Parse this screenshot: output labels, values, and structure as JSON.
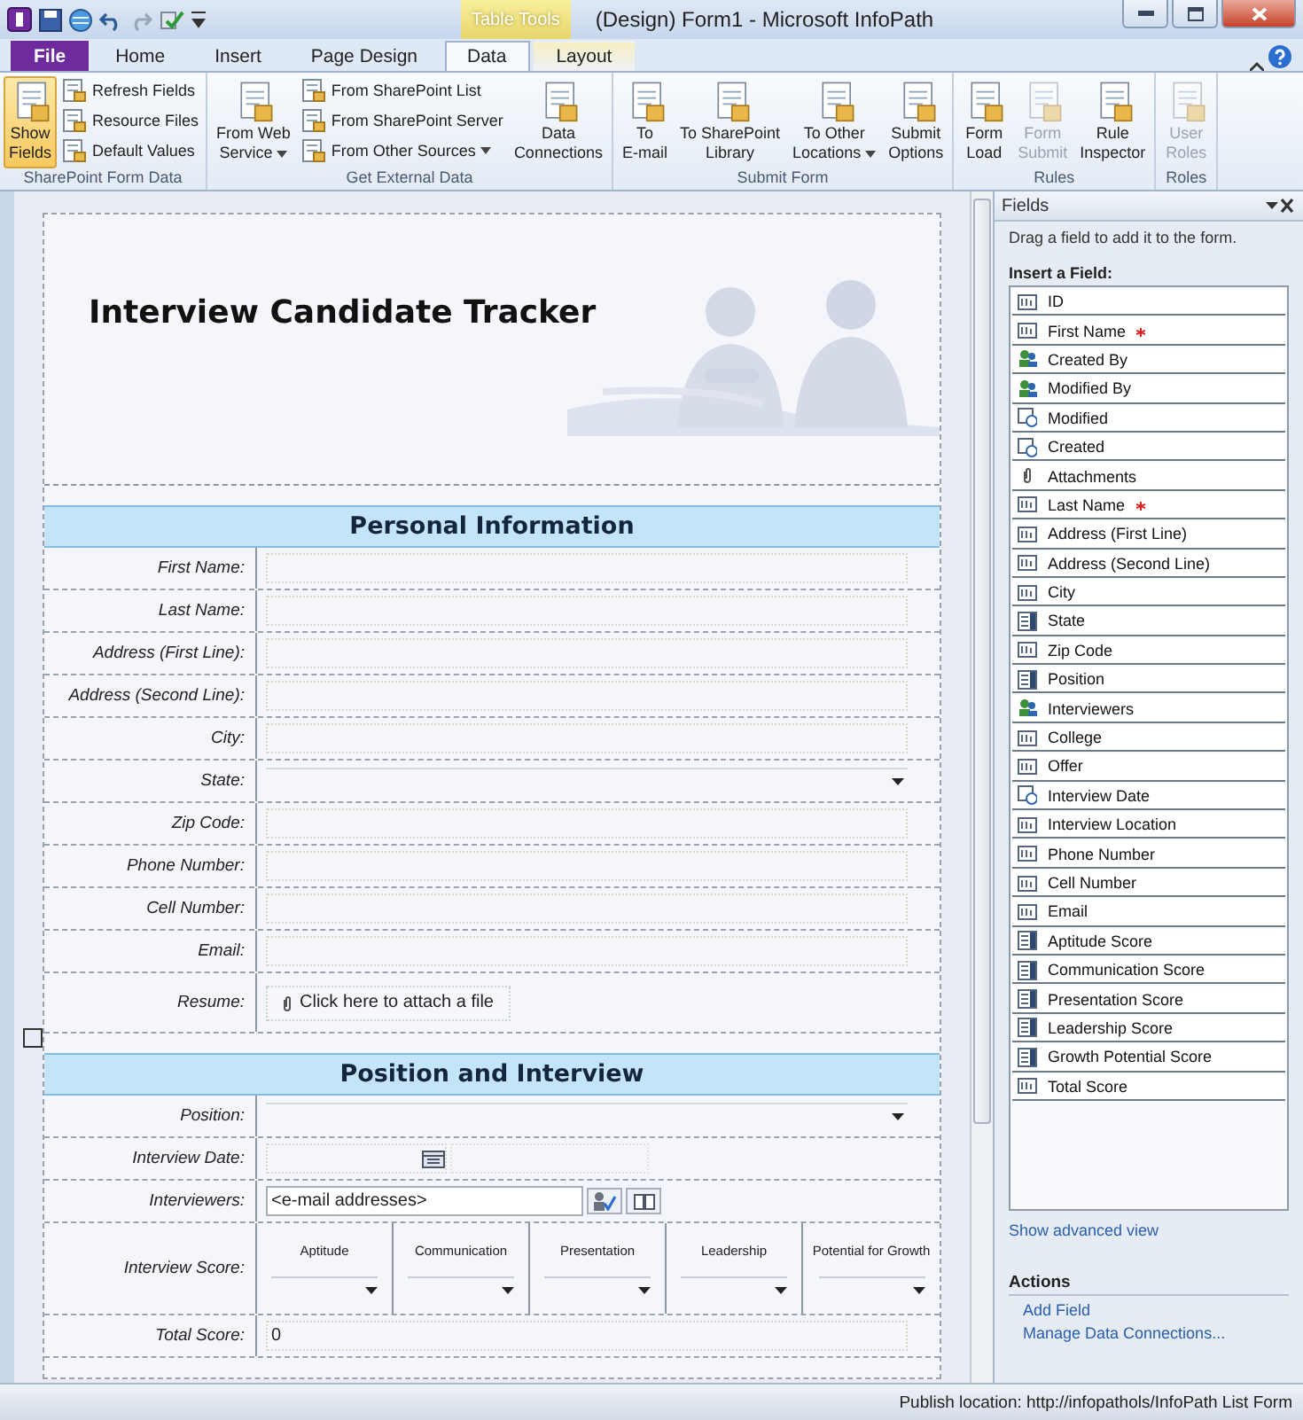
{
  "window": {
    "title": "(Design) Form1  -  Microsoft InfoPath",
    "context_label": "Table Tools"
  },
  "tabs": [
    {
      "label": "File",
      "kind": "file",
      "selected": false
    },
    {
      "label": "Home",
      "kind": "normal",
      "selected": false
    },
    {
      "label": "Insert",
      "kind": "normal",
      "selected": false
    },
    {
      "label": "Page Design",
      "kind": "normal",
      "selected": false
    },
    {
      "label": "Data",
      "kind": "normal",
      "selected": true
    },
    {
      "label": "Layout",
      "kind": "context",
      "selected": false
    }
  ],
  "ribbon_groups": [
    {
      "label": "SharePoint Form Data",
      "buttons": [
        {
          "kind": "large",
          "lines": [
            "Show",
            "Fields"
          ],
          "selected": true,
          "disabled": false,
          "dropdown": false
        },
        {
          "kind": "small",
          "lines": [
            "Refresh Fields"
          ],
          "selected": false,
          "disabled": false,
          "dropdown": false
        },
        {
          "kind": "small",
          "lines": [
            "Resource Files"
          ],
          "selected": false,
          "disabled": false,
          "dropdown": false
        },
        {
          "kind": "small",
          "lines": [
            "Default Values"
          ],
          "selected": false,
          "disabled": false,
          "dropdown": false
        }
      ]
    },
    {
      "label": "Get External Data",
      "buttons": [
        {
          "kind": "large",
          "lines": [
            "From Web",
            "Service"
          ],
          "selected": false,
          "disabled": false,
          "dropdown": true
        },
        {
          "kind": "small",
          "lines": [
            "From SharePoint List"
          ],
          "selected": false,
          "disabled": false,
          "dropdown": false
        },
        {
          "kind": "small",
          "lines": [
            "From SharePoint Server"
          ],
          "selected": false,
          "disabled": false,
          "dropdown": false
        },
        {
          "kind": "small",
          "lines": [
            "From Other Sources"
          ],
          "selected": false,
          "disabled": false,
          "dropdown": true
        },
        {
          "kind": "large",
          "lines": [
            "Data",
            "Connections"
          ],
          "selected": false,
          "disabled": false,
          "dropdown": false
        }
      ]
    },
    {
      "label": "Submit Form",
      "buttons": [
        {
          "kind": "large",
          "lines": [
            "To",
            "E-mail"
          ],
          "selected": false,
          "disabled": false,
          "dropdown": false
        },
        {
          "kind": "large",
          "lines": [
            "To SharePoint",
            "Library"
          ],
          "selected": false,
          "disabled": false,
          "dropdown": false
        },
        {
          "kind": "large",
          "lines": [
            "To Other",
            "Locations"
          ],
          "selected": false,
          "disabled": false,
          "dropdown": true
        },
        {
          "kind": "large",
          "lines": [
            "Submit",
            "Options"
          ],
          "selected": false,
          "disabled": false,
          "dropdown": false
        }
      ]
    },
    {
      "label": "Rules",
      "buttons": [
        {
          "kind": "large",
          "lines": [
            "Form",
            "Load"
          ],
          "selected": false,
          "disabled": false,
          "dropdown": false
        },
        {
          "kind": "large",
          "lines": [
            "Form",
            "Submit"
          ],
          "selected": false,
          "disabled": true,
          "dropdown": false
        },
        {
          "kind": "large",
          "lines": [
            "Rule",
            "Inspector"
          ],
          "selected": false,
          "disabled": false,
          "dropdown": false
        }
      ]
    },
    {
      "label": "Roles",
      "buttons": [
        {
          "kind": "large",
          "lines": [
            "User",
            "Roles"
          ],
          "selected": false,
          "disabled": true,
          "dropdown": false
        }
      ]
    }
  ],
  "form": {
    "title": "Interview Candidate Tracker",
    "sections": [
      {
        "heading": "Personal Information",
        "rows": [
          {
            "label": "First Name:",
            "kind": "text"
          },
          {
            "label": "Last Name:",
            "kind": "text"
          },
          {
            "label": "Address (First Line):",
            "kind": "text"
          },
          {
            "label": "Address (Second Line):",
            "kind": "text"
          },
          {
            "label": "City:",
            "kind": "text"
          },
          {
            "label": "State:",
            "kind": "dropdown"
          },
          {
            "label": "Zip Code:",
            "kind": "text"
          },
          {
            "label": "Phone Number:",
            "kind": "text"
          },
          {
            "label": "Cell Number:",
            "kind": "text"
          },
          {
            "label": "Email:",
            "kind": "text"
          },
          {
            "label": "Resume:",
            "kind": "attach",
            "value": "Click here to attach a file"
          }
        ]
      },
      {
        "heading": "Position and Interview",
        "rows": [
          {
            "label": "Position:",
            "kind": "dropdown"
          },
          {
            "label": "Interview Date:",
            "kind": "date"
          },
          {
            "label": "Interviewers:",
            "kind": "people",
            "placeholder": "<e-mail addresses>"
          },
          {
            "label": "Interview Score:",
            "kind": "scores",
            "columns": [
              "Aptitude",
              "Communication",
              "Presentation",
              "Leadership",
              "Potential for Growth"
            ]
          },
          {
            "label": "Total Score:",
            "kind": "text",
            "value": "0"
          }
        ]
      }
    ]
  },
  "fields_pane": {
    "title": "Fields",
    "hint": "Drag a field to add it to the form.",
    "list_label": "Insert a Field:",
    "fields": [
      {
        "name": "ID",
        "kind": "text",
        "required": false
      },
      {
        "name": "First Name",
        "kind": "text",
        "required": true
      },
      {
        "name": "Created By",
        "kind": "person",
        "required": false
      },
      {
        "name": "Modified By",
        "kind": "person",
        "required": false
      },
      {
        "name": "Modified",
        "kind": "date",
        "required": false
      },
      {
        "name": "Created",
        "kind": "date",
        "required": false
      },
      {
        "name": "Attachments",
        "kind": "attachment",
        "required": false
      },
      {
        "name": "Last Name",
        "kind": "text",
        "required": true
      },
      {
        "name": "Address (First Line)",
        "kind": "text",
        "required": false
      },
      {
        "name": "Address (Second Line)",
        "kind": "text",
        "required": false
      },
      {
        "name": "City",
        "kind": "text",
        "required": false
      },
      {
        "name": "State",
        "kind": "choice",
        "required": false
      },
      {
        "name": "Zip Code",
        "kind": "text",
        "required": false
      },
      {
        "name": "Position",
        "kind": "choice",
        "required": false
      },
      {
        "name": "Interviewers",
        "kind": "person",
        "required": false
      },
      {
        "name": "College",
        "kind": "text",
        "required": false
      },
      {
        "name": "Offer",
        "kind": "text",
        "required": false
      },
      {
        "name": "Interview Date",
        "kind": "date",
        "required": false
      },
      {
        "name": "Interview Location",
        "kind": "text",
        "required": false
      },
      {
        "name": "Phone Number",
        "kind": "text",
        "required": false
      },
      {
        "name": "Cell Number",
        "kind": "text",
        "required": false
      },
      {
        "name": "Email",
        "kind": "text",
        "required": false
      },
      {
        "name": "Aptitude Score",
        "kind": "choice",
        "required": false
      },
      {
        "name": "Communication Score",
        "kind": "choice",
        "required": false
      },
      {
        "name": "Presentation Score",
        "kind": "choice",
        "required": false
      },
      {
        "name": "Leadership Score",
        "kind": "choice",
        "required": false
      },
      {
        "name": "Growth Potential Score",
        "kind": "choice",
        "required": false
      },
      {
        "name": "Total Score",
        "kind": "text",
        "required": false
      }
    ],
    "advanced_link": "Show advanced view",
    "actions_heading": "Actions",
    "actions": [
      "Add Field",
      "Manage Data Connections..."
    ]
  },
  "status_bar": {
    "text": "Publish location: http://infopathols/InfoPath List Form"
  }
}
